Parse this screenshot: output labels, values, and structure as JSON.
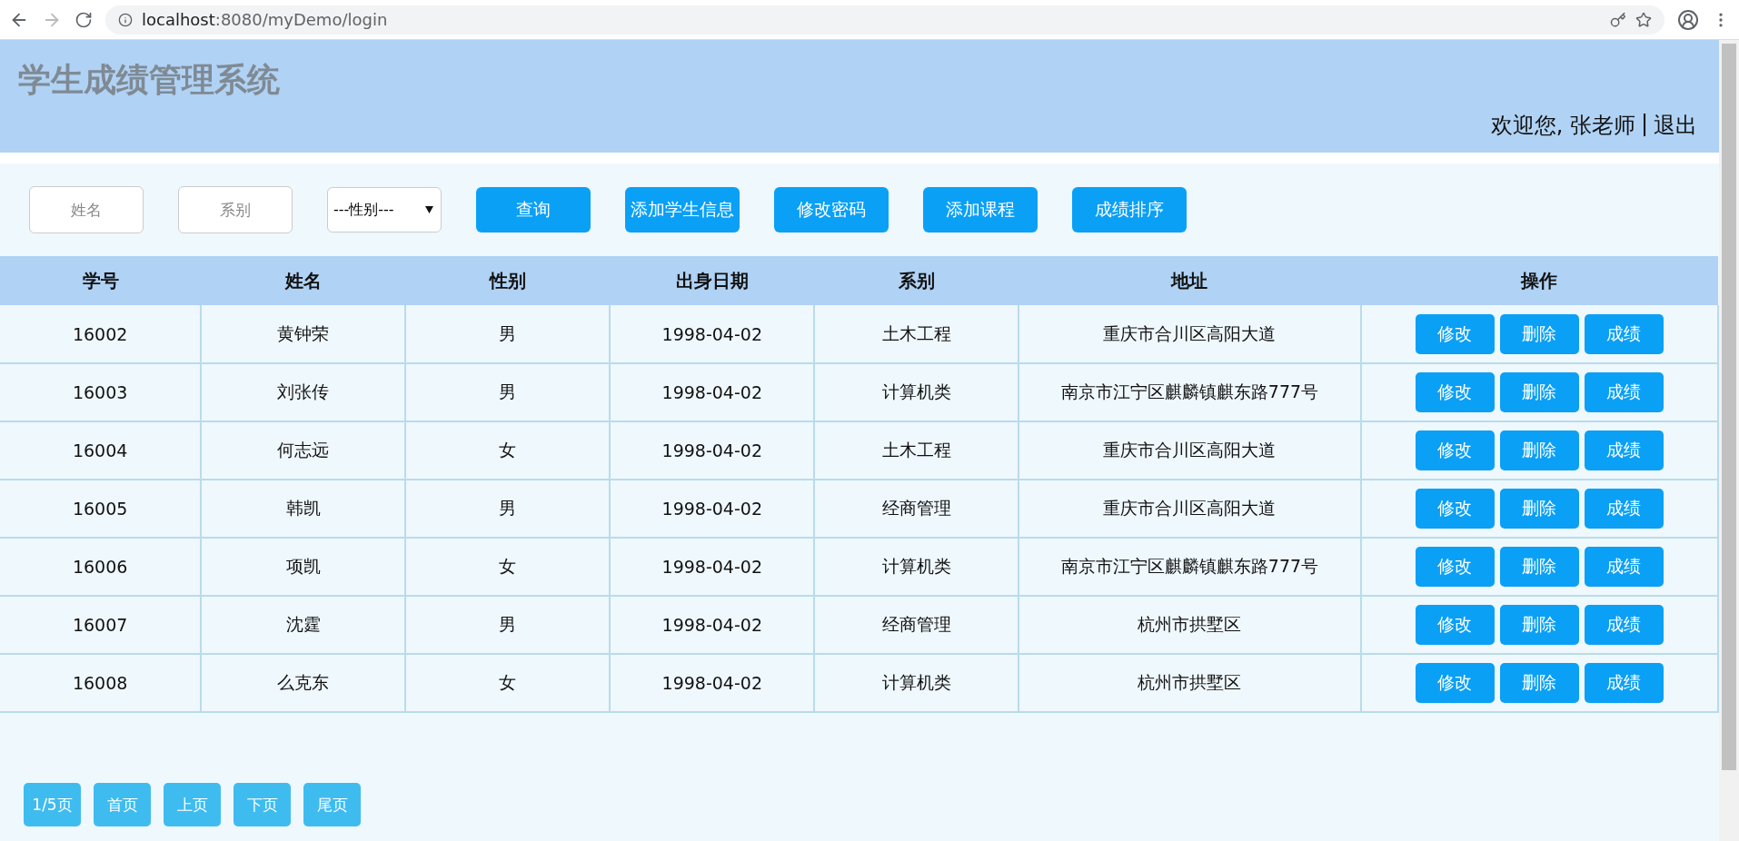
{
  "browser": {
    "url_host": "localhost",
    "url_rest": ":8080/myDemo/login"
  },
  "header": {
    "title": "学生成绩管理系统",
    "greeting": "欢迎您, 张老师",
    "separator": "|",
    "logout": "退出"
  },
  "filters": {
    "name_placeholder": "姓名",
    "dept_placeholder": "系别",
    "gender_select": "---性别---"
  },
  "toolbar_buttons": [
    "查询",
    "添加学生信息",
    "修改密码",
    "添加课程",
    "成绩排序"
  ],
  "table": {
    "columns": [
      "学号",
      "姓名",
      "性别",
      "出身日期",
      "系别",
      "地址",
      "操作"
    ],
    "rows": [
      {
        "cells": [
          "16002",
          "黄钟荣",
          "男",
          "1998-04-02",
          "土木工程",
          "重庆市合川区高阳大道"
        ],
        "actions": [
          "修改",
          "删除",
          "成绩"
        ]
      },
      {
        "cells": [
          "16003",
          "刘张传",
          "男",
          "1998-04-02",
          "计算机类",
          "南京市江宁区麒麟镇麒东路777号"
        ],
        "actions": [
          "修改",
          "删除",
          "成绩"
        ]
      },
      {
        "cells": [
          "16004",
          "何志远",
          "女",
          "1998-04-02",
          "土木工程",
          "重庆市合川区高阳大道"
        ],
        "actions": [
          "修改",
          "删除",
          "成绩"
        ]
      },
      {
        "cells": [
          "16005",
          "韩凯",
          "男",
          "1998-04-02",
          "经商管理",
          "重庆市合川区高阳大道"
        ],
        "actions": [
          "修改",
          "删除",
          "成绩"
        ]
      },
      {
        "cells": [
          "16006",
          "项凯",
          "女",
          "1998-04-02",
          "计算机类",
          "南京市江宁区麒麟镇麒东路777号"
        ],
        "actions": [
          "修改",
          "删除",
          "成绩"
        ]
      },
      {
        "cells": [
          "16007",
          "沈霆",
          "男",
          "1998-04-02",
          "经商管理",
          "杭州市拱墅区"
        ],
        "actions": [
          "修改",
          "删除",
          "成绩"
        ]
      },
      {
        "cells": [
          "16008",
          "么克东",
          "女",
          "1998-04-02",
          "计算机类",
          "杭州市拱墅区"
        ],
        "actions": [
          "修改",
          "删除",
          "成绩"
        ]
      }
    ]
  },
  "pagination": [
    "1/5页",
    "首页",
    "上页",
    "下页",
    "尾页"
  ]
}
